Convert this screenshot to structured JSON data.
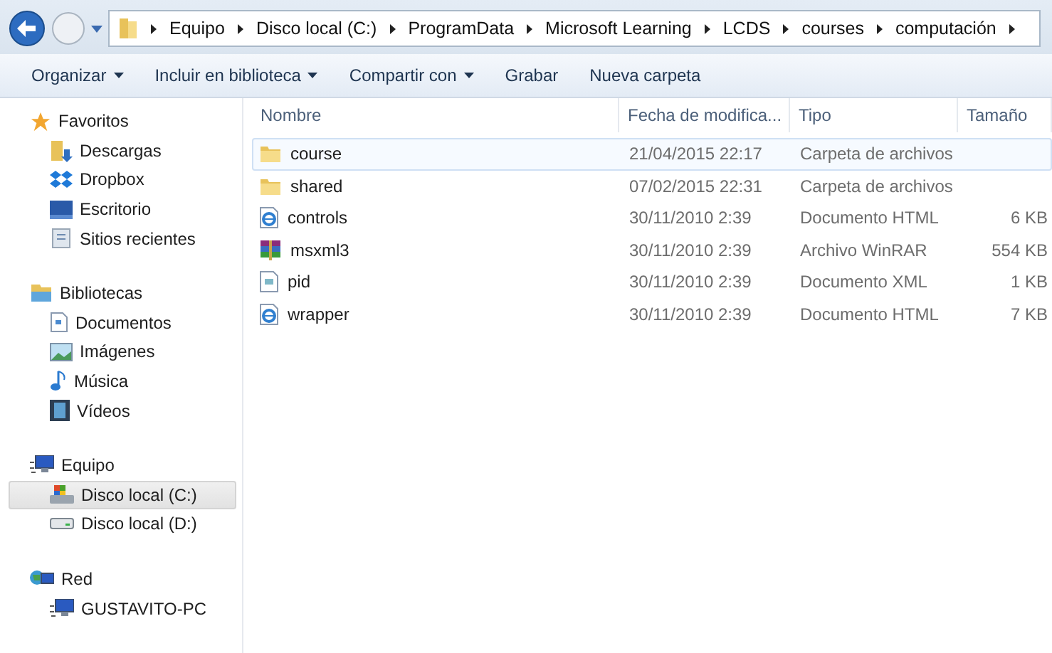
{
  "address": {
    "crumbs": [
      "Equipo",
      "Disco local (C:)",
      "ProgramData",
      "Microsoft Learning",
      "LCDS",
      "courses",
      "computación"
    ]
  },
  "toolbar": [
    {
      "label": "Organizar",
      "dropdown": true
    },
    {
      "label": "Incluir en biblioteca",
      "dropdown": true
    },
    {
      "label": "Compartir con",
      "dropdown": true
    },
    {
      "label": "Grabar",
      "dropdown": false
    },
    {
      "label": "Nueva carpeta",
      "dropdown": false
    }
  ],
  "sidebar": [
    {
      "label": "Favoritos",
      "kind": "star",
      "children": [
        {
          "label": "Descargas",
          "kind": "download",
          "selected": false
        },
        {
          "label": "Dropbox",
          "kind": "dropbox",
          "selected": false
        },
        {
          "label": "Escritorio",
          "kind": "desktop",
          "selected": false
        },
        {
          "label": "Sitios recientes",
          "kind": "recent",
          "selected": false
        }
      ]
    },
    {
      "label": "Bibliotecas",
      "kind": "library",
      "children": [
        {
          "label": "Documentos",
          "kind": "document",
          "selected": false
        },
        {
          "label": "Imágenes",
          "kind": "image",
          "selected": false
        },
        {
          "label": "Música",
          "kind": "music",
          "selected": false
        },
        {
          "label": "Vídeos",
          "kind": "video",
          "selected": false
        }
      ]
    },
    {
      "label": "Equipo",
      "kind": "computer",
      "children": [
        {
          "label": "Disco local (C:)",
          "kind": "sysdrive",
          "selected": true
        },
        {
          "label": "Disco local (D:)",
          "kind": "drive",
          "selected": false
        }
      ]
    },
    {
      "label": "Red",
      "kind": "network",
      "children": [
        {
          "label": "GUSTAVITO-PC",
          "kind": "computer",
          "selected": false
        }
      ]
    }
  ],
  "table": {
    "columns": [
      "Nombre",
      "Fecha de modifica...",
      "Tipo",
      "Tamaño"
    ],
    "rows": [
      {
        "name": "course",
        "kind": "folder",
        "date": "21/04/2015 22:17",
        "type": "Carpeta de archivos",
        "selected": true
      },
      {
        "name": "shared",
        "kind": "folder",
        "date": "07/02/2015 22:31",
        "type": "Carpeta de archivos",
        "selected": false
      },
      {
        "name": "controls",
        "kind": "html",
        "date": "30/11/2010 2:39",
        "type": "Documento HTML",
        "size": "6 KB",
        "selected": false
      },
      {
        "name": "msxml3",
        "kind": "rar",
        "date": "30/11/2010 2:39",
        "type": "Archivo WinRAR",
        "size": "554 KB",
        "selected": false
      },
      {
        "name": "pid",
        "kind": "xml",
        "date": "30/11/2010 2:39",
        "type": "Documento XML",
        "size": "1 KB",
        "selected": false
      },
      {
        "name": "wrapper",
        "kind": "html",
        "date": "30/11/2010 2:39",
        "type": "Documento HTML",
        "size": "7 KB",
        "selected": false
      }
    ]
  }
}
